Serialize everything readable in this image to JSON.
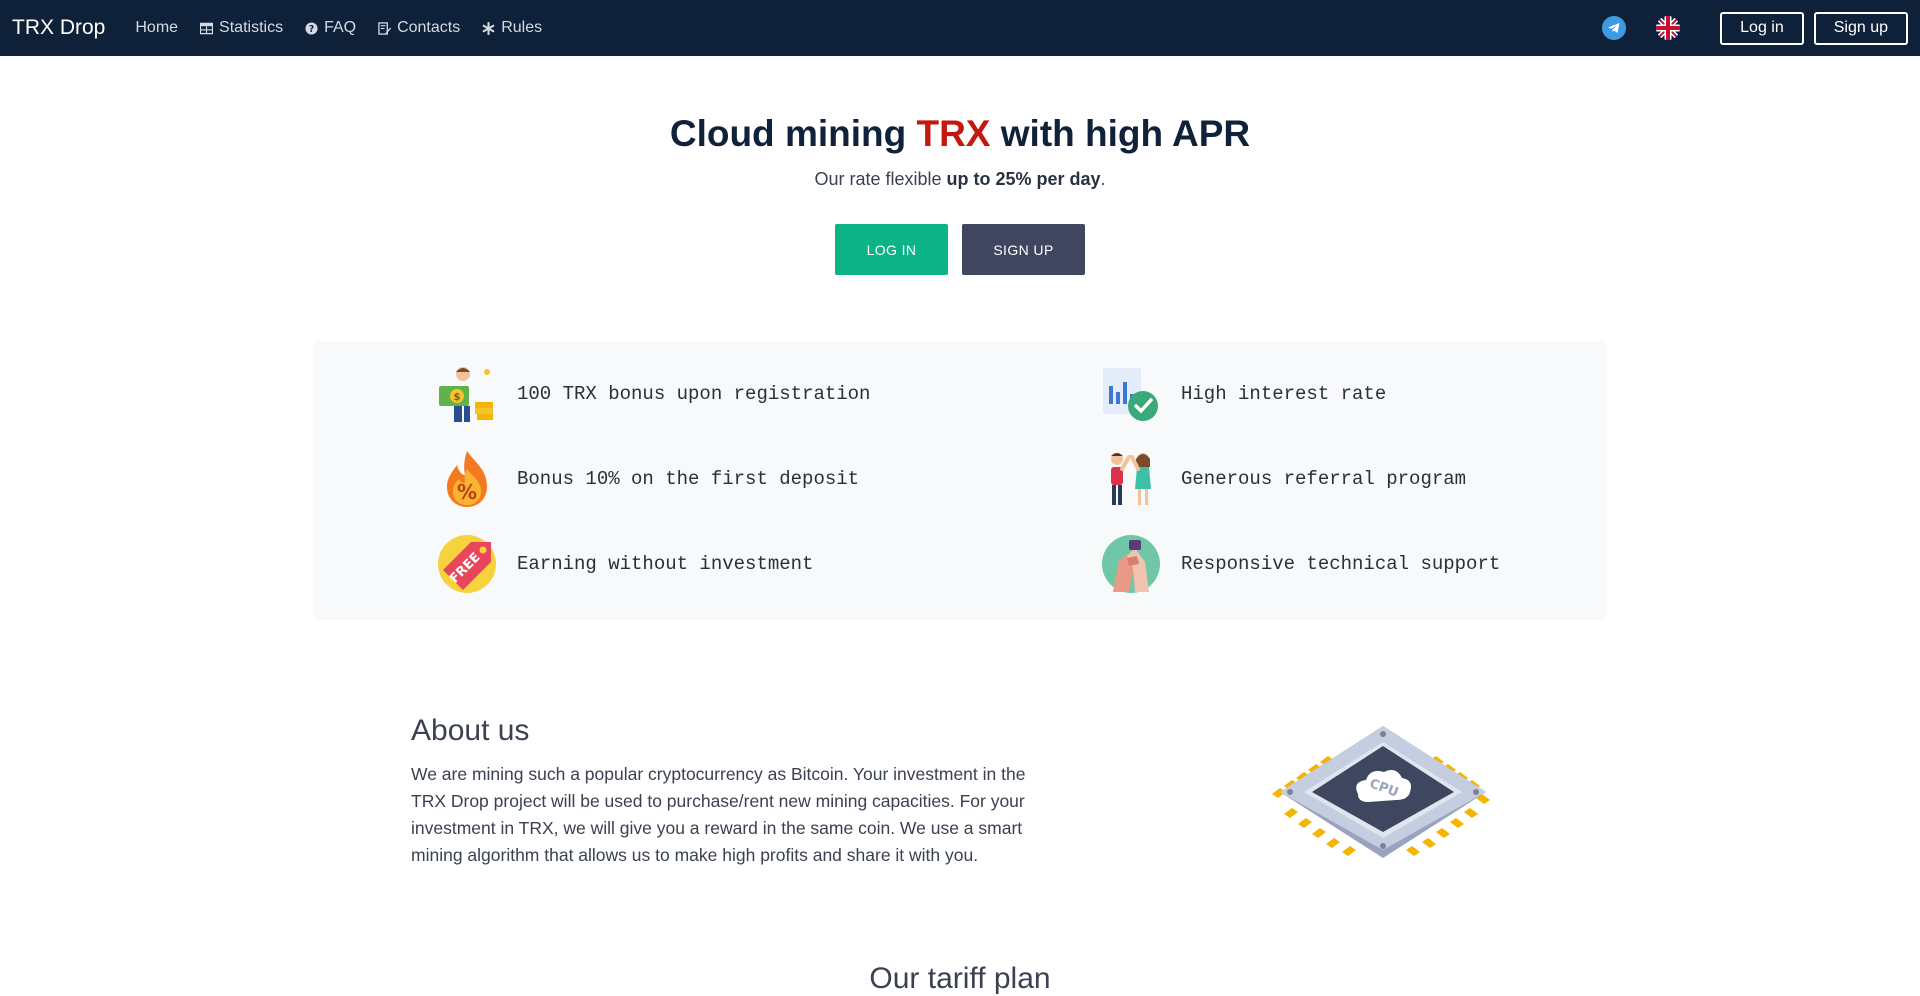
{
  "navbar": {
    "brand": "TRX Drop",
    "items": [
      {
        "label": "Home"
      },
      {
        "label": "Statistics"
      },
      {
        "label": "FAQ"
      },
      {
        "label": "Contacts"
      },
      {
        "label": "Rules"
      }
    ],
    "login_label": "Log in",
    "signup_label": "Sign up"
  },
  "hero": {
    "title_before": "Cloud mining ",
    "title_accent": "TRX",
    "title_after": " with high APR",
    "subtitle_before": "Our rate flexible ",
    "subtitle_bold": "up to 25% per day",
    "subtitle_after": ".",
    "login_button": "LOG IN",
    "signup_button": "SIGN UP"
  },
  "features": [
    {
      "text": "100 TRX bonus upon registration",
      "icon": "money-bonus-icon"
    },
    {
      "text": "High interest rate",
      "icon": "chart-check-icon"
    },
    {
      "text": "Bonus 10% on the first deposit",
      "icon": "fire-percent-icon"
    },
    {
      "text": "Generous referral program",
      "icon": "people-high-five-icon"
    },
    {
      "text": "Earning without investment",
      "icon": "free-tag-icon"
    },
    {
      "text": "Responsive technical support",
      "icon": "handshake-icon"
    }
  ],
  "about": {
    "title": "About us",
    "text": "We are mining such a popular cryptocurrency as Bitcoin. Your investment in the TRX Drop project will be used to purchase/rent new mining capacities. For your investment in TRX, we will give you a reward in the same coin. We use a smart mining algorithm that allows us to make high profits and share it with you.",
    "image_label": "CPU"
  },
  "tariff": {
    "title": "Our tariff plan"
  },
  "colors": {
    "navbar": "#0f2139",
    "accent": "#c4170f",
    "login": "#0bb386",
    "signup": "#404660"
  }
}
